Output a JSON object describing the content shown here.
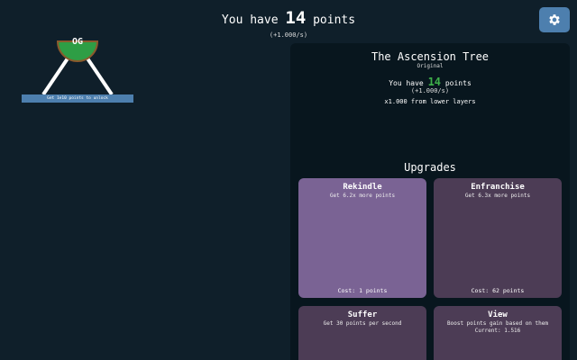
{
  "header": {
    "prefix": "You have",
    "points": "14",
    "suffix": "points",
    "rate": "(+1.000/s)"
  },
  "settings": {
    "icon": "gear-icon"
  },
  "tree": {
    "node_label": "OG",
    "node_color": "#2e9e45",
    "unlock_text": "Get 1e10 points to unlock"
  },
  "panel": {
    "title": "The Ascension Tree",
    "subtitle": "Original",
    "points_prefix": "You have",
    "points": "14",
    "points_suffix": "points",
    "rate": "(+1.000/s)",
    "multiplier": "x1.000 from lower layers",
    "upgrades_heading": "Upgrades"
  },
  "upgrades": [
    {
      "title": "Rekindle",
      "desc": "Get 6.2x more points",
      "cost": "Cost: 1 points"
    },
    {
      "title": "Enfranchise",
      "desc": "Get 6.3x more points",
      "cost": "Cost: 62 points"
    },
    {
      "title": "Suffer",
      "desc": "Get 30 points per second",
      "cost": ""
    },
    {
      "title": "View",
      "desc": "Boost points gain based on them",
      "current": "Current: 1.516"
    }
  ]
}
